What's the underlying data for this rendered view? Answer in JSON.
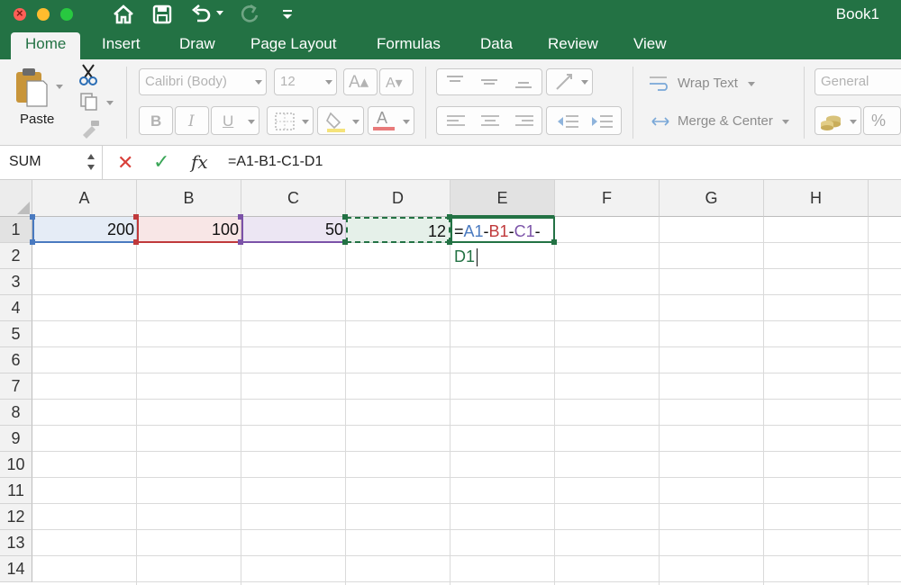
{
  "window": {
    "title": "Book1"
  },
  "tabs": [
    {
      "label": "Home",
      "active": true
    },
    {
      "label": "Insert"
    },
    {
      "label": "Draw"
    },
    {
      "label": "Page Layout"
    },
    {
      "label": "Formulas"
    },
    {
      "label": "Data"
    },
    {
      "label": "Review"
    },
    {
      "label": "View"
    }
  ],
  "ribbon": {
    "paste_label": "Paste",
    "font_name": "Calibri (Body)",
    "font_size": "12",
    "bold": "B",
    "italic": "I",
    "underline": "U",
    "wrap_text": "Wrap Text",
    "merge_center": "Merge & Center",
    "number_format": "General",
    "percent": "%"
  },
  "formula_bar": {
    "name_box": "SUM",
    "fx": "fx",
    "formula": "=A1-B1-C1-D1"
  },
  "grid": {
    "columns": [
      "A",
      "B",
      "C",
      "D",
      "E",
      "F",
      "G",
      "H"
    ],
    "rows": [
      "1",
      "2",
      "3",
      "4",
      "5",
      "6",
      "7",
      "8",
      "9",
      "10",
      "11",
      "12",
      "13",
      "14"
    ],
    "selected_column": "E",
    "selected_row": "1",
    "cells": {
      "A1": "200",
      "B1": "100",
      "C1": "50",
      "D1": "12"
    },
    "edit_cell": {
      "eq": "=",
      "p1": "A1",
      "op1": "-",
      "p2": "B1",
      "op2": "-",
      "p3": "C1",
      "op3": "-",
      "p4": "D1"
    }
  },
  "colors": {
    "brand": "#237244",
    "ref_a": "#4a7ac0",
    "ref_b": "#c0393b",
    "ref_c": "#7b52a8",
    "ref_d": "#237244"
  }
}
